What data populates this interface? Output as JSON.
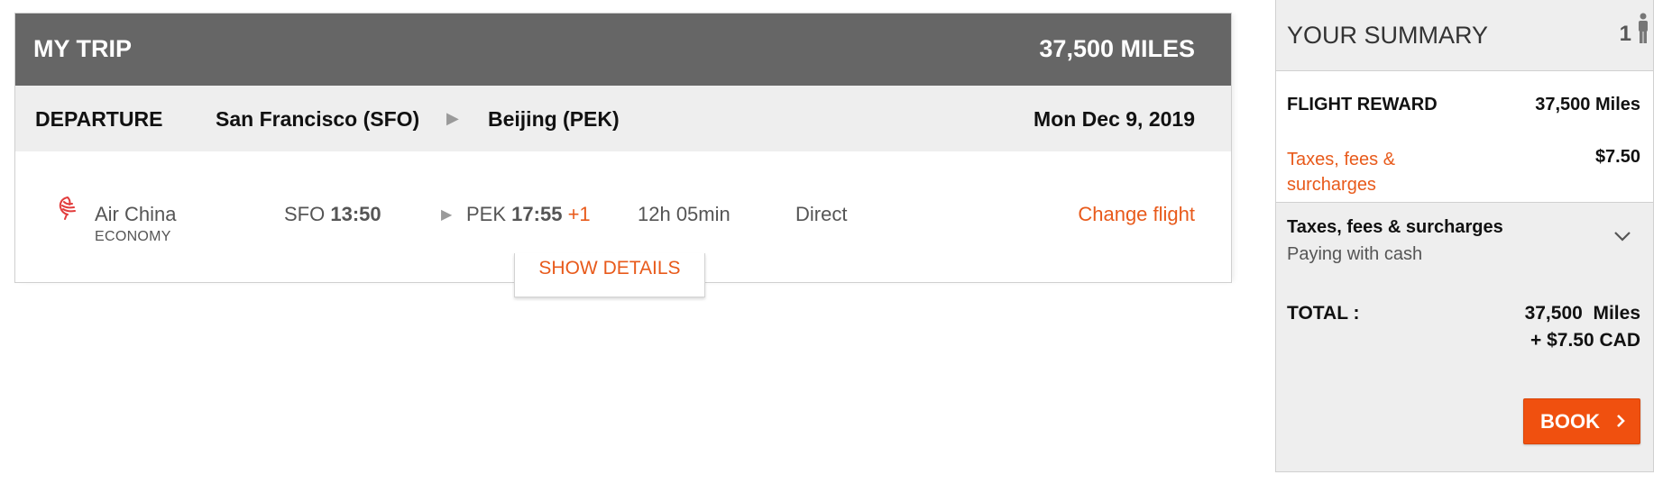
{
  "trip": {
    "title": "MY TRIP",
    "miles": "37,500 MILES",
    "departure": {
      "label": "DEPARTURE",
      "origin": "San Francisco (SFO)",
      "destination": "Beijing (PEK)",
      "date": "Mon Dec 9, 2019"
    },
    "flight": {
      "airline": "Air China",
      "cabin": "ECONOMY",
      "dep_airport": "SFO",
      "dep_time": "13:50",
      "arr_airport": "PEK",
      "arr_time": "17:55",
      "day_offset": "+1",
      "duration": "12h 05min",
      "stops": "Direct",
      "change_label": "Change flight"
    },
    "show_details_label": "SHOW DETAILS"
  },
  "summary": {
    "title": "YOUR SUMMARY",
    "passengers": "1",
    "reward_label": "FLIGHT REWARD",
    "reward_value": "37,500 Miles",
    "taxes_label": "Taxes, fees & surcharges",
    "taxes_value": "$7.50",
    "tax_toggle_title": "Taxes, fees & surcharges",
    "tax_toggle_sub": "Paying with cash",
    "total_label": "TOTAL :",
    "total_miles": "37,500  Miles",
    "total_cash": "+ $7.50 CAD",
    "book_label": "BOOK"
  },
  "colors": {
    "accent": "#e85a1b",
    "header": "#666666",
    "book_button": "#f0500f"
  },
  "icons": [
    "air-china-logo-icon",
    "person-icon",
    "chevron-right-icon",
    "chevron-down-icon"
  ]
}
